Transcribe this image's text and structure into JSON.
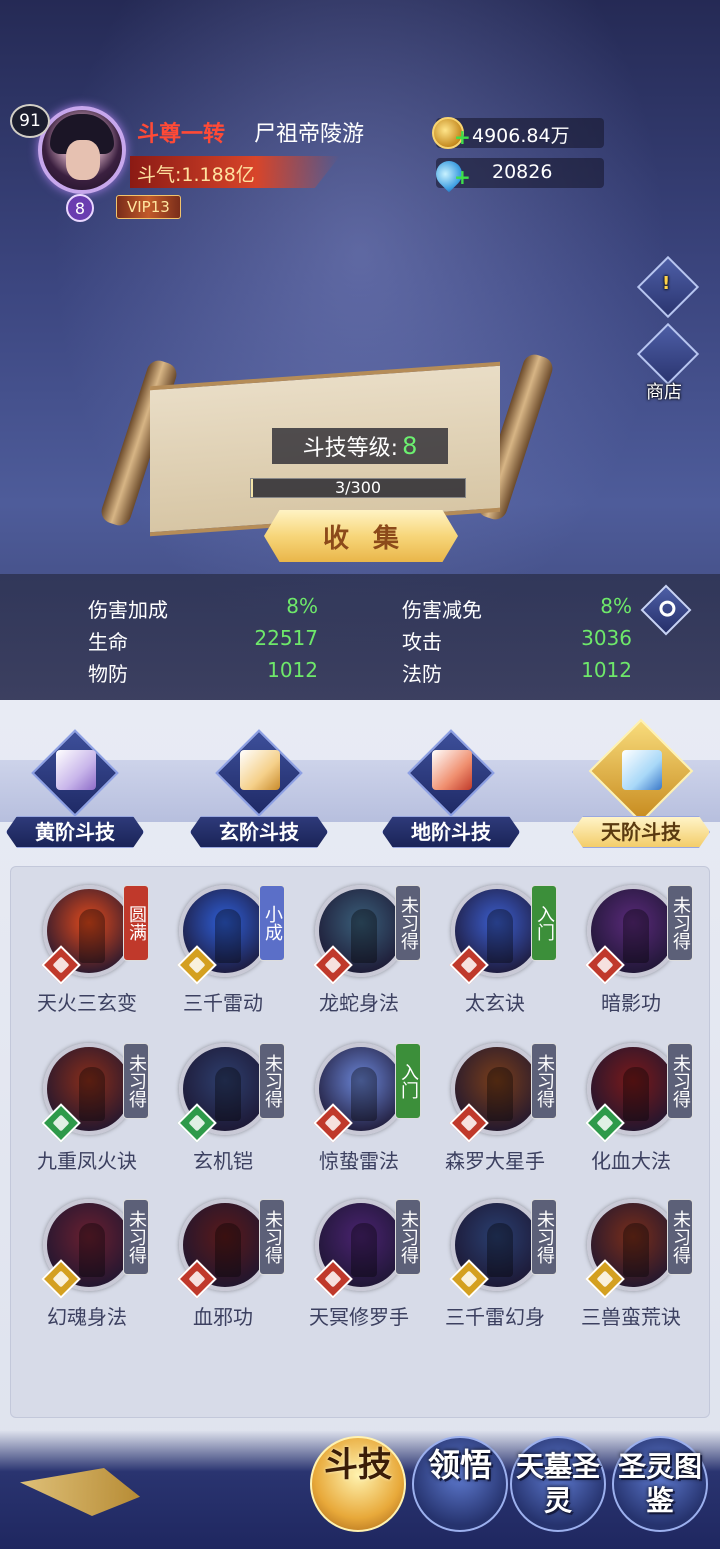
{
  "header": {
    "player_level": "91",
    "star_level": "8",
    "vip": "VIP13",
    "rank": "斗尊一转",
    "name": "尸祖帝陵游",
    "power": "斗气:1.188亿",
    "gold": "4906.84万",
    "crystal": "20826"
  },
  "side": {
    "info_icon": "!",
    "shop_label": "商店"
  },
  "scroll": {
    "level_label": "斗技等级:",
    "level_value": "8",
    "progress_text": "3/300",
    "progress": 0.01,
    "collect_label": "收集"
  },
  "stats": [
    {
      "label": "伤害加成",
      "value": "8%"
    },
    {
      "label": "伤害减免",
      "value": "8%"
    },
    {
      "label": "生命",
      "value": "22517"
    },
    {
      "label": "攻击",
      "value": "3036"
    },
    {
      "label": "物防",
      "value": "1012"
    },
    {
      "label": "法防",
      "value": "1012"
    }
  ],
  "tabs": [
    {
      "label": "黄阶斗技",
      "active": false
    },
    {
      "label": "玄阶斗技",
      "active": false
    },
    {
      "label": "地阶斗技",
      "active": false
    },
    {
      "label": "天阶斗技",
      "active": true
    }
  ],
  "skills": [
    {
      "name": "天火三玄变",
      "tag": "圆满",
      "tag_color": "#c0392b",
      "orb_color": "#e24a1c",
      "grade_color": "#c0392b"
    },
    {
      "name": "三千雷动",
      "tag": "小成",
      "tag_color": "#5b6fc8",
      "orb_color": "#2f5fd8",
      "grade_color": "#d4a020"
    },
    {
      "name": "龙蛇身法",
      "tag": "未习得",
      "tag_color": "#5c6078",
      "orb_color": "#3a5f7a",
      "grade_color": "#c0392b"
    },
    {
      "name": "太玄诀",
      "tag": "入门",
      "tag_color": "#3c8f3a",
      "orb_color": "#3c5fd0",
      "grade_color": "#c0392b"
    },
    {
      "name": "暗影功",
      "tag": "未习得",
      "tag_color": "#5c6078",
      "orb_color": "#5a2a7a",
      "grade_color": "#c0392b"
    },
    {
      "name": "九重凤火诀",
      "tag": "未习得",
      "tag_color": "#5c6078",
      "orb_color": "#8a2e1a",
      "grade_color": "#2e9a4a"
    },
    {
      "name": "玄机铠",
      "tag": "未习得",
      "tag_color": "#5c6078",
      "orb_color": "#2e3f6e",
      "grade_color": "#2e9a4a"
    },
    {
      "name": "惊蛰雷法",
      "tag": "入门",
      "tag_color": "#3c8f3a",
      "orb_color": "#6b86d8",
      "grade_color": "#c0392b"
    },
    {
      "name": "森罗大星手",
      "tag": "未习得",
      "tag_color": "#5c6078",
      "orb_color": "#7a3e1a",
      "grade_color": "#c0392b"
    },
    {
      "name": "化血大法",
      "tag": "未习得",
      "tag_color": "#5c6078",
      "orb_color": "#7a1a1a",
      "grade_color": "#2e9a4a"
    },
    {
      "name": "幻魂身法",
      "tag": "未习得",
      "tag_color": "#5c6078",
      "orb_color": "#6a2030",
      "grade_color": "#d4a020"
    },
    {
      "name": "血邪功",
      "tag": "未习得",
      "tag_color": "#5c6078",
      "orb_color": "#5a1a1a",
      "grade_color": "#c0392b"
    },
    {
      "name": "天冥修罗手",
      "tag": "未习得",
      "tag_color": "#5c6078",
      "orb_color": "#4a2370",
      "grade_color": "#c0392b"
    },
    {
      "name": "三千雷幻身",
      "tag": "未习得",
      "tag_color": "#5c6078",
      "orb_color": "#2a3f70",
      "grade_color": "#d4a020"
    },
    {
      "name": "三兽蛮荒诀",
      "tag": "未习得",
      "tag_color": "#5c6078",
      "orb_color": "#7a2e1a",
      "grade_color": "#d4a020"
    }
  ],
  "nav": [
    {
      "label": "斗技",
      "active": true
    },
    {
      "label": "领悟",
      "active": false
    },
    {
      "label": "天墓圣灵",
      "active": false
    },
    {
      "label": "圣灵图鉴",
      "active": false
    }
  ]
}
